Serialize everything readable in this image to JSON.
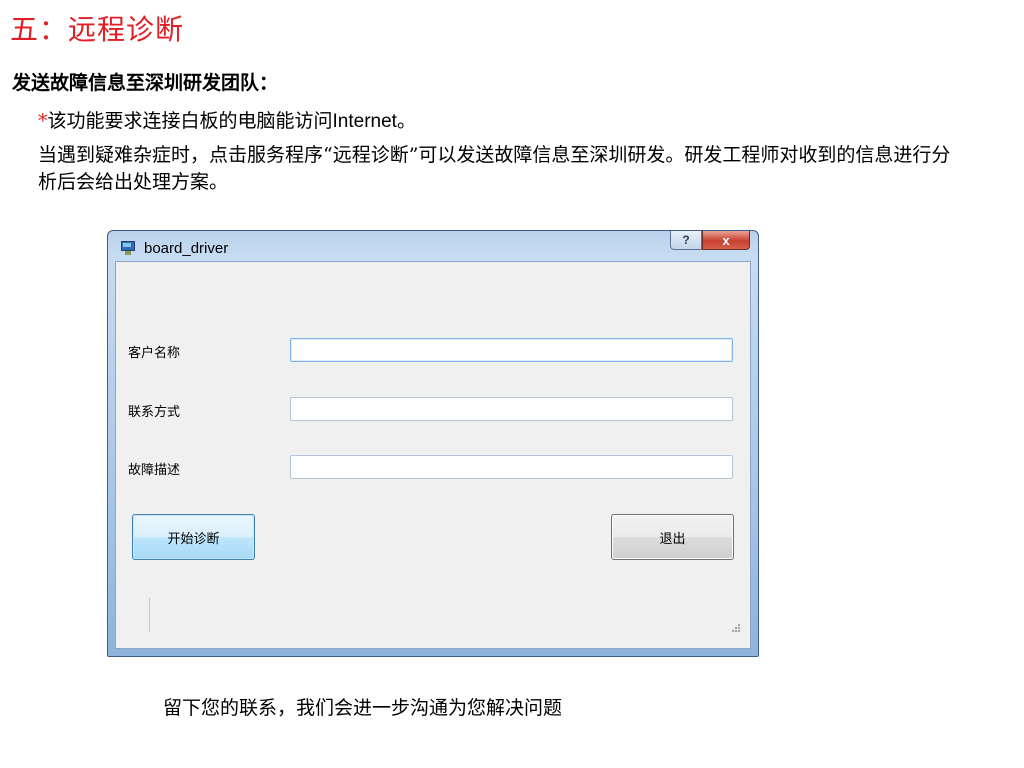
{
  "slide": {
    "title": "五：远程诊断",
    "subtitle": "发送故障信息至深圳研发团队：",
    "note_star": "*",
    "note_text": "该功能要求连接白板的电脑能访问",
    "note_latin": "Internet",
    "note_end": "。",
    "paragraph": "当遇到疑难杂症时，点击服务程序“远程诊断”可以发送故障信息至深圳研发。研发工程师对收到的信息进行分析后会给出处理方案。",
    "caption": "留下您的联系，我们会进一步沟通为您解决问题"
  },
  "window": {
    "title": "board_driver",
    "help_glyph": "?",
    "close_glyph": "x",
    "fields": [
      {
        "label": "客户名称",
        "value": ""
      },
      {
        "label": "联系方式",
        "value": ""
      },
      {
        "label": "故障描述",
        "value": ""
      }
    ],
    "start_button": "开始诊断",
    "exit_button": "退出"
  },
  "icons": {
    "app": "monitor-icon",
    "help": "help-icon",
    "close": "close-icon",
    "resize": "resize-grip-icon"
  },
  "colors": {
    "title_red": "#e31e24",
    "accent_blue": "#3c7fb1"
  }
}
